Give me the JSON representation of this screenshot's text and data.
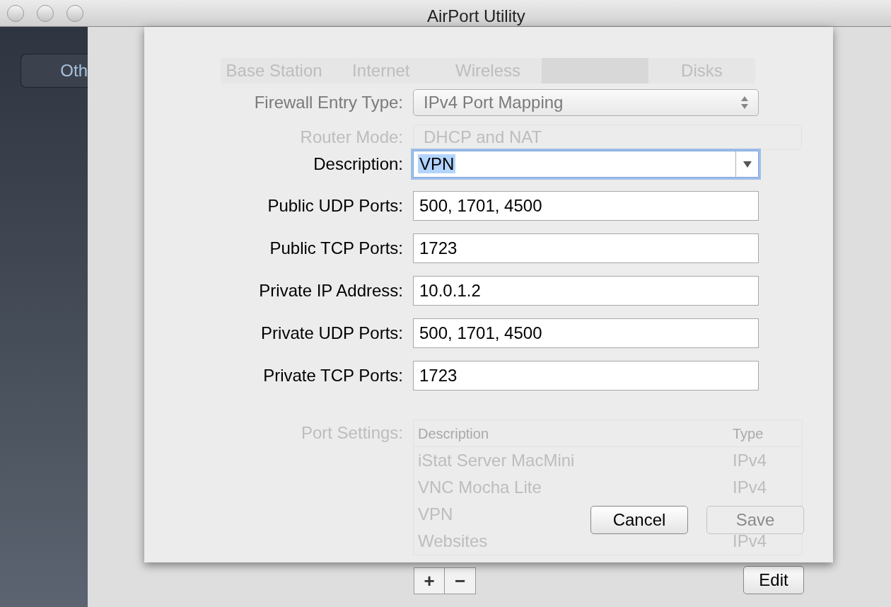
{
  "window": {
    "title": "AirPort Utility"
  },
  "sidebar": {
    "items": [
      {
        "label": "Oth"
      }
    ]
  },
  "background": {
    "tabs": [
      {
        "label": "Base Station",
        "selected": false
      },
      {
        "label": "Internet",
        "selected": false
      },
      {
        "label": "Wireless",
        "selected": false
      },
      {
        "selected": true
      },
      {
        "label": "Disks",
        "selected": false
      }
    ],
    "router_mode": {
      "label": "Router Mode:",
      "value": "DHCP and NAT"
    },
    "port_settings": {
      "label": "Port Settings:",
      "columns": [
        "Description",
        "Type"
      ],
      "rows": [
        {
          "description": "iStat Server MacMini",
          "type": "IPv4"
        },
        {
          "description": "VNC Mocha Lite",
          "type": "IPv4"
        },
        {
          "description": "VPN"
        },
        {
          "description": "Websites",
          "type": "IPv4"
        }
      ]
    },
    "add_button": "+",
    "remove_button": "−",
    "edit_button": "Edit"
  },
  "sheet": {
    "entry_type": {
      "label": "Firewall Entry Type:",
      "value": "IPv4 Port Mapping",
      "disabled": true
    },
    "fields": [
      {
        "kind": "combo",
        "label": "Description:",
        "value": "VPN",
        "focused": true
      },
      {
        "kind": "text",
        "label": "Public UDP Ports:",
        "value": "500, 1701, 4500",
        "focused": false
      },
      {
        "kind": "text",
        "label": "Public TCP Ports:",
        "value": "1723",
        "focused": false
      },
      {
        "kind": "text",
        "label": "Private IP Address:",
        "value": "10.0.1.2",
        "focused": false
      },
      {
        "kind": "text",
        "label": "Private UDP Ports:",
        "value": "500, 1701, 4500",
        "focused": false
      },
      {
        "kind": "text",
        "label": "Private TCP Ports:",
        "value": "1723",
        "focused": false
      }
    ],
    "buttons": [
      {
        "label": "Cancel",
        "disabled": false
      },
      {
        "label": "Save",
        "disabled": true
      }
    ]
  }
}
